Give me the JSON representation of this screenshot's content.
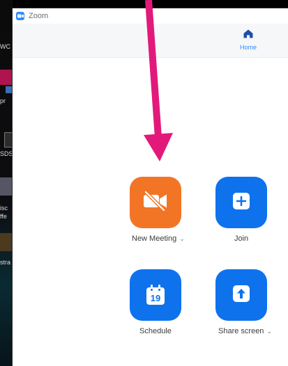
{
  "window": {
    "title": "Zoom"
  },
  "nav": {
    "home_label": "Home"
  },
  "actions": {
    "new_meeting": "New Meeting",
    "join": "Join",
    "schedule": "Schedule",
    "schedule_day": "19",
    "share_screen": "Share screen"
  },
  "desktop_fragments": [
    "WC",
    "pr",
    "SDS",
    "isc",
    "ffe",
    "stra"
  ],
  "colors": {
    "orange": "#f27526",
    "blue": "#0e72ed",
    "accent": "#2d8cff",
    "annotation": "#e2197a"
  },
  "icons": {
    "app": "zoom-camera-icon",
    "home": "home-icon",
    "new_meeting": "video-off-icon",
    "join": "plus-icon",
    "schedule": "calendar-icon",
    "share": "arrow-up-icon"
  }
}
